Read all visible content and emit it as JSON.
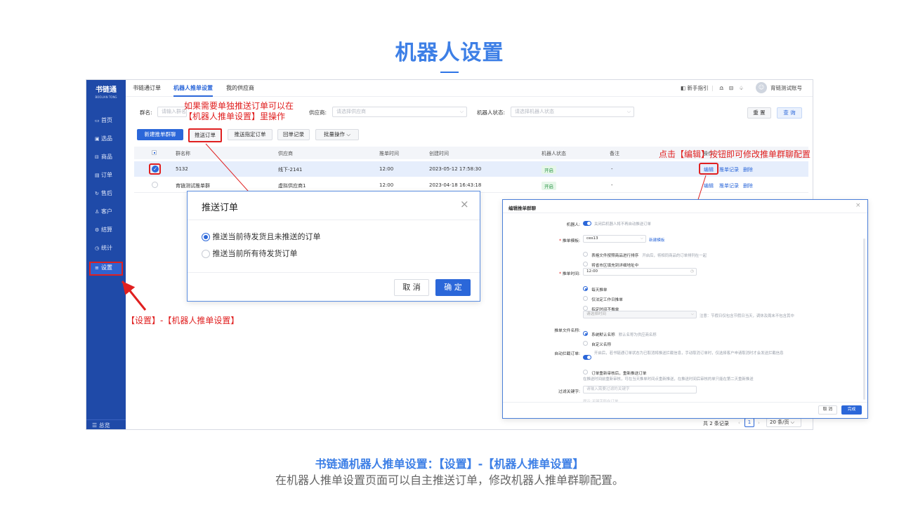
{
  "page": {
    "title": "机器人设置",
    "caption_title": "书链通机器人推单设置：【设置】-【机器人推单设置】",
    "caption_desc": "在机器人推单设置页面可以自主推送订单，修改机器人推单群聊配置。"
  },
  "colors": {
    "accent": "#2b67d9",
    "sidebar": "#1f4aa8",
    "annotation": "#e02020",
    "status_green": "#2e9a4a"
  },
  "sidebar": {
    "logo": "书链通",
    "logo_sub": "BOOLIAN TONG",
    "items": [
      {
        "icon": "home-icon",
        "label": "首页"
      },
      {
        "icon": "grid-icon",
        "label": "选品"
      },
      {
        "icon": "box-icon",
        "label": "商品"
      },
      {
        "icon": "order-icon",
        "label": "订单"
      },
      {
        "icon": "refund-icon",
        "label": "售后"
      },
      {
        "icon": "customer-icon",
        "label": "客户"
      },
      {
        "icon": "settle-icon",
        "label": "结算"
      },
      {
        "icon": "stats-icon",
        "label": "统计"
      },
      {
        "icon": "settings-icon",
        "label": "设置"
      }
    ],
    "overview": "总览"
  },
  "topbar": {
    "tabs": [
      "书链通订单",
      "机器人推单设置",
      "我的供应商"
    ],
    "active_tab": 1,
    "guide": "新手指引",
    "account": "育链测试账号"
  },
  "filters": {
    "group_label": "群名:",
    "group_placeholder": "请输入群名",
    "supplier_label": "供应商:",
    "supplier_placeholder": "请选择供应商",
    "status_label": "机器人状态:",
    "status_placeholder": "请选择机器人状态",
    "reset": "重 置",
    "search": "查 询"
  },
  "toolbar": {
    "new_group": "新建推单群聊",
    "push_order": "推送订单",
    "push_specified": "推送指定订单",
    "callback_log": "回单记录",
    "batch": "批量操作"
  },
  "table": {
    "headers": [
      "群名称",
      "供应商",
      "推单时间",
      "创建时间",
      "机器人状态",
      "备注",
      "操作"
    ],
    "rows": [
      {
        "name": "5132",
        "supplier": "线下-2141",
        "push_time": "12:00",
        "created": "2023-05-12 17:58:30",
        "status": "开启",
        "remark": "-",
        "checked": true
      },
      {
        "name": "育链测试推单群",
        "supplier": "虚拟供应商1",
        "push_time": "12:00",
        "created": "2023-04-18 16:43:18",
        "status": "开启",
        "remark": "-",
        "checked": false
      }
    ],
    "actions": [
      "编辑",
      "推单记录",
      "删除"
    ]
  },
  "pagination": {
    "total": "共 2 条记录",
    "page": "1",
    "per_page": "20 条/页"
  },
  "annotations": {
    "push_note_line1": "如果需要单独推送订单可以在",
    "push_note_line2": "【机器人推单设置】里操作",
    "edit_note": "点击【编辑】按钮即可修改推单群聊配置",
    "settings_note": "【设置】-【机器人推单设置】"
  },
  "push_modal": {
    "title": "推送订单",
    "options": [
      "推送当前待发货且未推送的订单",
      "推送当前所有待发货订单"
    ],
    "selected": 0,
    "cancel": "取 消",
    "confirm": "确 定"
  },
  "edit_modal": {
    "title": "编辑推单群聊",
    "robot_label": "机器人:",
    "robot_hint": "关闭后机器人将不再自动推送订单",
    "template_label": "推单模板:",
    "template_value": "ces13",
    "new_template": "新建模板",
    "sort_option": "表格文件按照商品进行排序",
    "sort_hint": "开启后，将相同商品的订单排列在一起",
    "address_option": "将省市区填充到详细地址中",
    "time_label": "推单时间:",
    "time_value": "12:00",
    "time_options": [
      "每天推单",
      "仅法定工作日推单",
      "指定时间不推单"
    ],
    "time_select_placeholder": "请选择时间",
    "time_note": "注意：节假日仅包含节假日当天，调休及周末不包含其中",
    "filename_label": "推单文件名称:",
    "filename_options": [
      "系统默认名称",
      "自定义名称"
    ],
    "filename_hint": "默认名称为供应商名称",
    "intercept_label": "自动拦截订单:",
    "intercept_hint": "开启后，若书链通订单状态为已取消将推送拦截信息，手动取消订单时，仅选择客户申请取消时才会发送拦截信息",
    "repush_option": "订单重新审核后，重新推送订单",
    "repush_hint": "在推送时间前重新审核，可在当天推单时间点重新推送，在推送时间后审核的单只能在第二天重新推送",
    "keyword_label": "过滤关键字:",
    "keyword_placeholder": "请输入需要过滤的关键字",
    "keyword_hint": "提示:关键字所在订单...",
    "cancel": "取 消",
    "confirm": "完成"
  }
}
